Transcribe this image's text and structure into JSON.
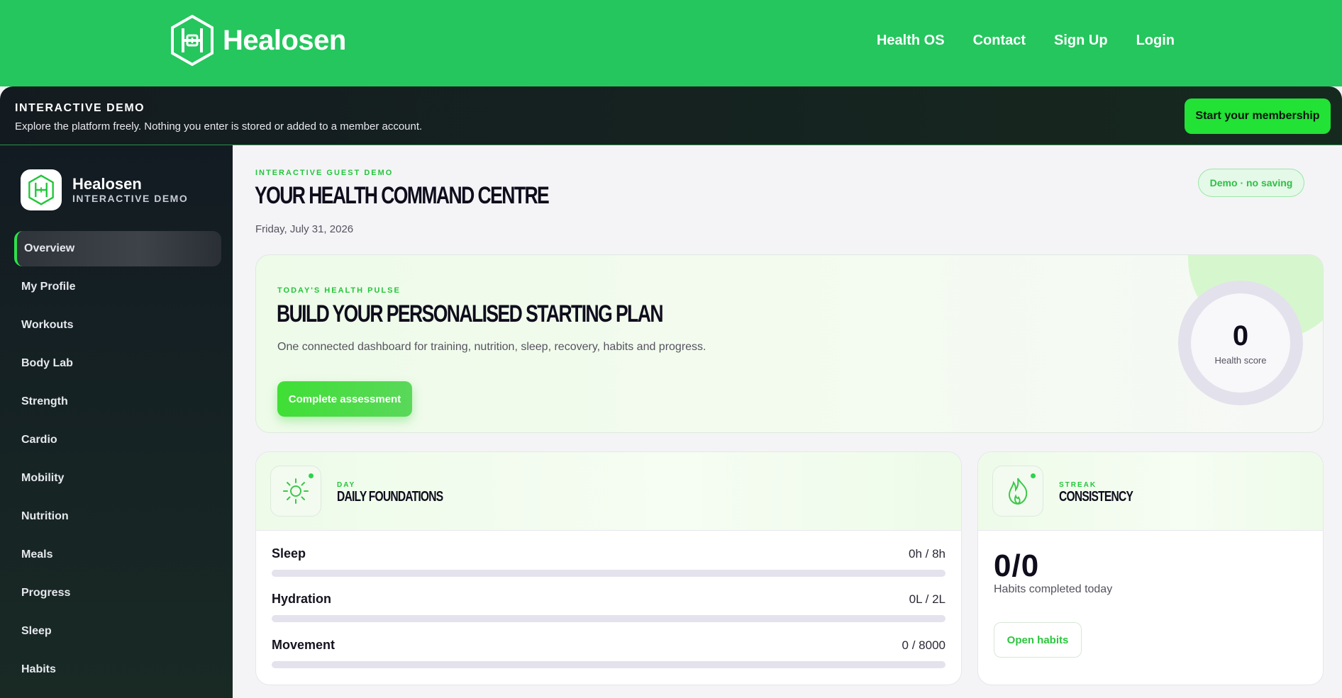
{
  "topnav": {
    "brand": "Healosen",
    "links": [
      "Health OS",
      "Contact",
      "Sign Up",
      "Login"
    ]
  },
  "banner": {
    "title": "INTERACTIVE DEMO",
    "subtitle": "Explore the platform freely. Nothing you enter is stored or added to a member account.",
    "cta": "Start your membership"
  },
  "sidebar": {
    "brand": "Healosen",
    "brand_sub": "INTERACTIVE DEMO",
    "items": [
      {
        "label": "Overview",
        "active": true
      },
      {
        "label": "My Profile"
      },
      {
        "label": "Workouts"
      },
      {
        "label": "Body Lab"
      },
      {
        "label": "Strength"
      },
      {
        "label": "Cardio"
      },
      {
        "label": "Mobility"
      },
      {
        "label": "Nutrition"
      },
      {
        "label": "Meals"
      },
      {
        "label": "Progress"
      },
      {
        "label": "Sleep"
      },
      {
        "label": "Habits"
      }
    ]
  },
  "main": {
    "eyebrow": "INTERACTIVE GUEST DEMO",
    "title": "YOUR HEALTH COMMAND CENTRE",
    "date": "Friday, July 31, 2026",
    "pill": "Demo · no saving"
  },
  "pulse": {
    "eyebrow": "TODAY'S HEALTH PULSE",
    "title": "BUILD YOUR PERSONALISED STARTING PLAN",
    "description": "One connected dashboard for training, nutrition, sleep, recovery, habits and progress.",
    "button": "Complete assessment",
    "score": "0",
    "score_label": "Health score"
  },
  "foundations": {
    "eyebrow": "DAY",
    "title": "DAILY FOUNDATIONS",
    "icon": "sun-icon",
    "metrics": [
      {
        "name": "Sleep",
        "value": "0h / 8h",
        "progress": 0
      },
      {
        "name": "Hydration",
        "value": "0L / 2L",
        "progress": 0
      },
      {
        "name": "Movement",
        "value": "0 / 8000",
        "progress": 0
      }
    ]
  },
  "consistency": {
    "eyebrow": "STREAK",
    "title": "CONSISTENCY",
    "icon": "flame-icon",
    "count": "0/0",
    "label": "Habits completed today",
    "button": "Open habits"
  },
  "colors": {
    "brand_green": "#24c65d",
    "accent_green": "#22e236",
    "sidebar_dark": "#121b22"
  }
}
